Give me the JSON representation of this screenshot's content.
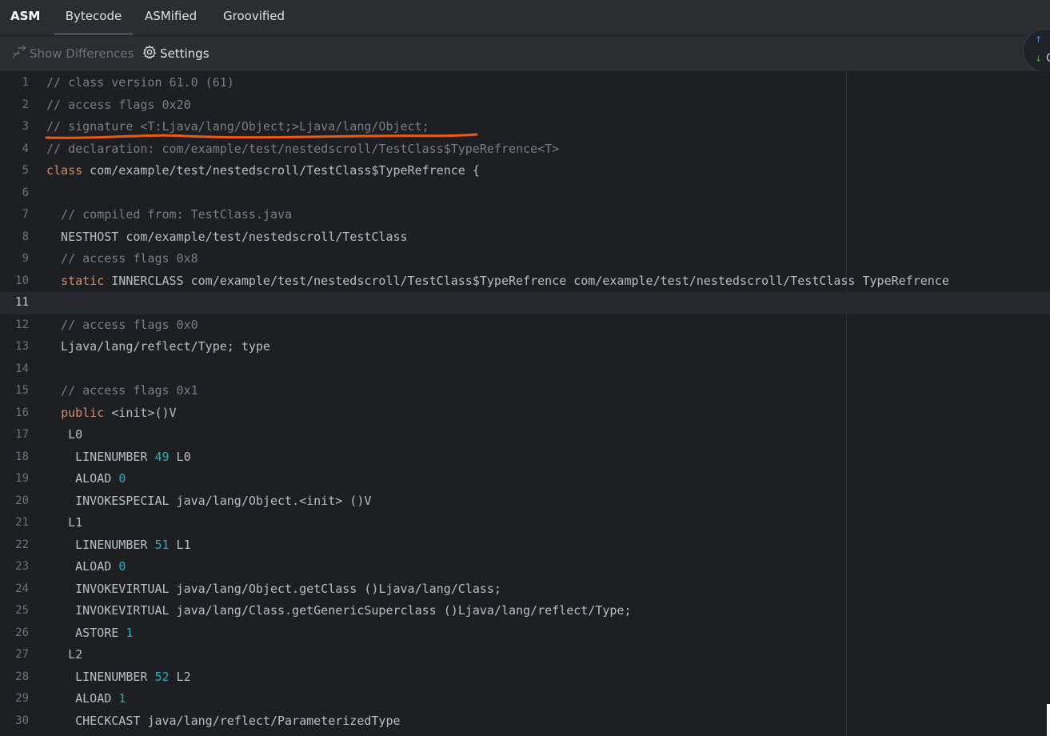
{
  "tabs": {
    "asm": "ASM",
    "bytecode": "Bytecode",
    "asmified": "ASMified",
    "groovified": "Groovified"
  },
  "toolbar": {
    "show_differences": "Show Differences",
    "settings": "Settings"
  },
  "scroll_widget": {
    "partial_text": "C"
  },
  "editor": {
    "current_line": 11,
    "lines": [
      {
        "n": "1",
        "t": "// class version 61.0 (61)"
      },
      {
        "n": "2",
        "t": "// access flags 0x20"
      },
      {
        "n": "3",
        "t": "// signature <T:Ljava/lang/Object;>Ljava/lang/Object;"
      },
      {
        "n": "4",
        "t": "// declaration: com/example/test/nestedscroll/TestClass$TypeRefrence<T>"
      },
      {
        "n": "5",
        "t": "class com/example/test/nestedscroll/TestClass$TypeRefrence {"
      },
      {
        "n": "6",
        "t": ""
      },
      {
        "n": "7",
        "t": "  // compiled from: TestClass.java"
      },
      {
        "n": "8",
        "t": "  NESTHOST com/example/test/nestedscroll/TestClass"
      },
      {
        "n": "9",
        "t": "  // access flags 0x8"
      },
      {
        "n": "10",
        "t": "  static INNERCLASS com/example/test/nestedscroll/TestClass$TypeRefrence com/example/test/nestedscroll/TestClass TypeRefrence"
      },
      {
        "n": "11",
        "t": ""
      },
      {
        "n": "12",
        "t": "  // access flags 0x0"
      },
      {
        "n": "13",
        "t": "  Ljava/lang/reflect/Type; type"
      },
      {
        "n": "14",
        "t": ""
      },
      {
        "n": "15",
        "t": "  // access flags 0x1"
      },
      {
        "n": "16",
        "t": "  public <init>()V"
      },
      {
        "n": "17",
        "t": "   L0"
      },
      {
        "n": "18",
        "t": "    LINENUMBER 49 L0"
      },
      {
        "n": "19",
        "t": "    ALOAD 0"
      },
      {
        "n": "20",
        "t": "    INVOKESPECIAL java/lang/Object.<init> ()V"
      },
      {
        "n": "21",
        "t": "   L1"
      },
      {
        "n": "22",
        "t": "    LINENUMBER 51 L1"
      },
      {
        "n": "23",
        "t": "    ALOAD 0"
      },
      {
        "n": "24",
        "t": "    INVOKEVIRTUAL java/lang/Object.getClass ()Ljava/lang/Class;"
      },
      {
        "n": "25",
        "t": "    INVOKEVIRTUAL java/lang/Class.getGenericSuperclass ()Ljava/lang/reflect/Type;"
      },
      {
        "n": "26",
        "t": "    ASTORE 1"
      },
      {
        "n": "27",
        "t": "   L2"
      },
      {
        "n": "28",
        "t": "    LINENUMBER 52 L2"
      },
      {
        "n": "29",
        "t": "    ALOAD 1"
      },
      {
        "n": "30",
        "t": "    CHECKCAST java/lang/reflect/ParameterizedType"
      }
    ]
  },
  "colors": {
    "comment": "#7a7e85",
    "keyword": "#cf8e6d",
    "number": "#2aacb8",
    "text": "#bcbec4",
    "annotation": "#f05a10"
  }
}
